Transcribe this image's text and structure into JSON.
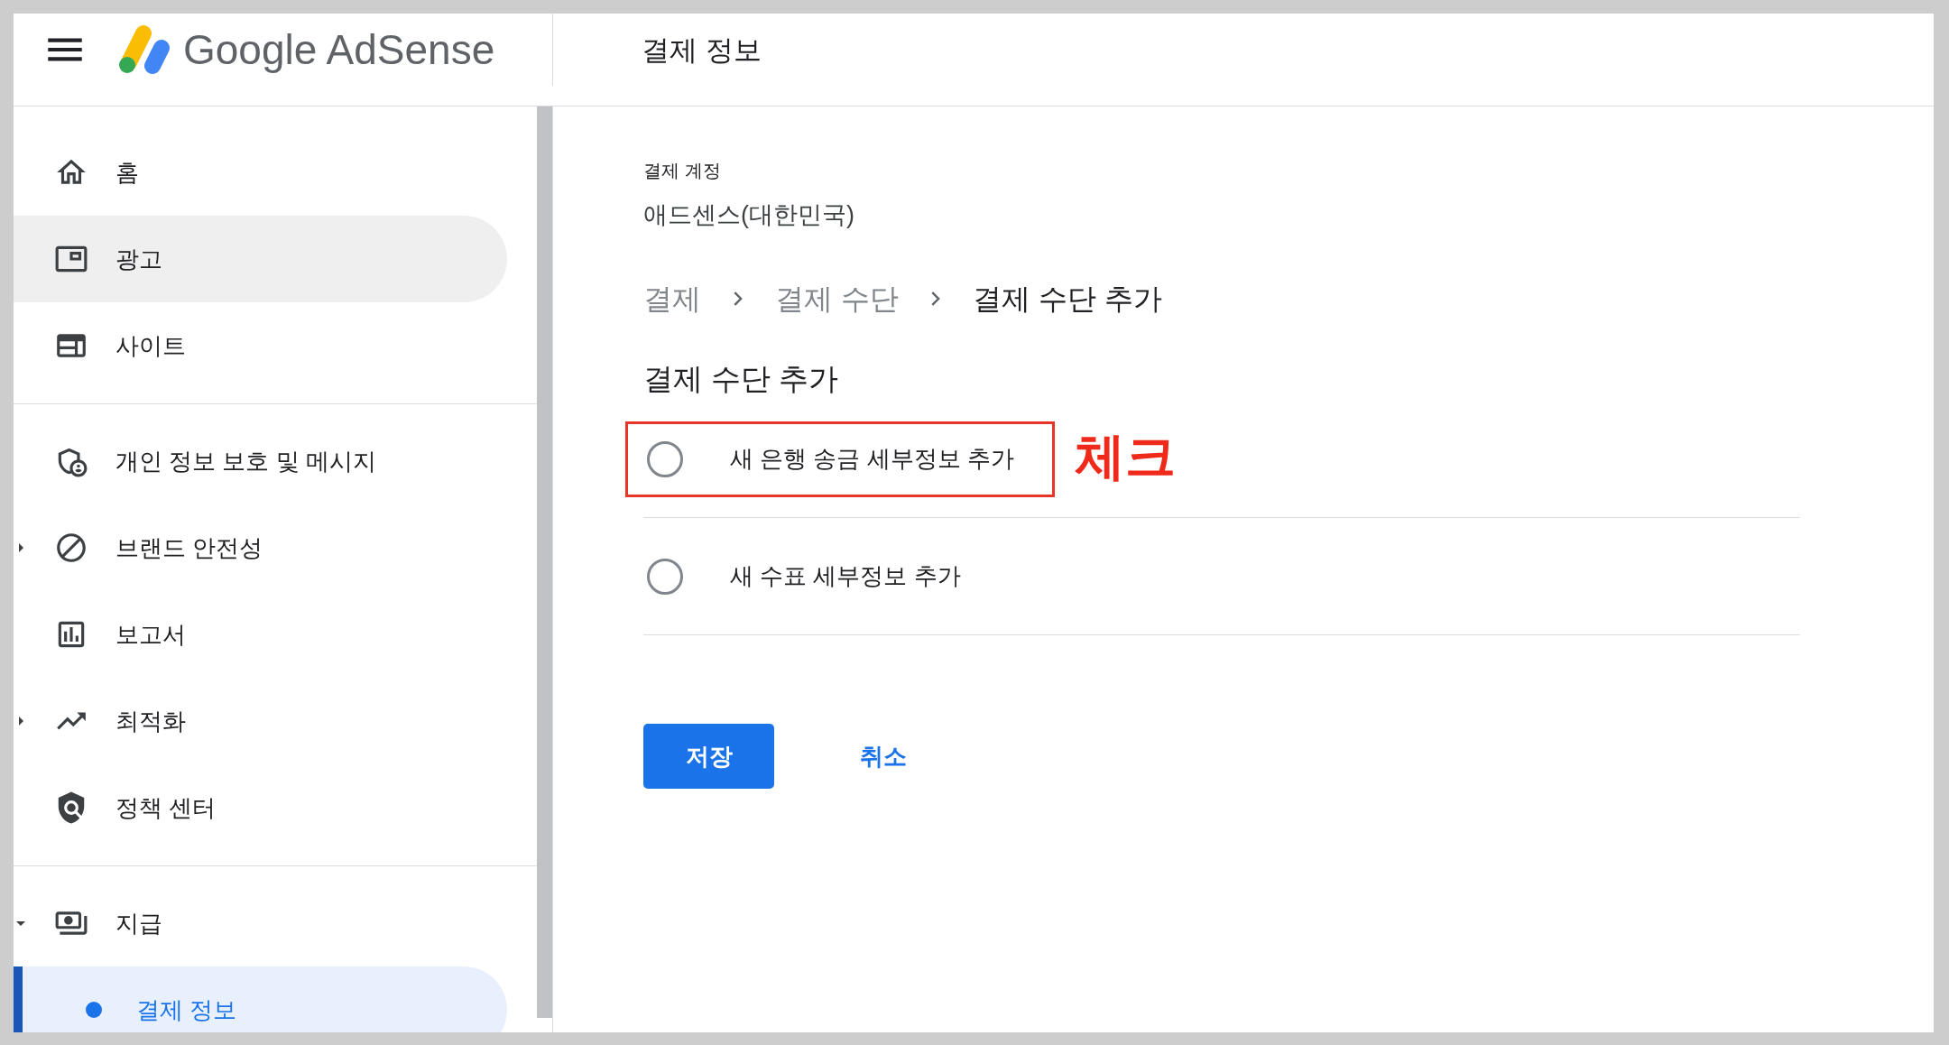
{
  "header": {
    "logo_text": "Google AdSense",
    "title": "결제 정보"
  },
  "sidebar": {
    "sections": [
      {
        "items": [
          {
            "label": "홈",
            "hovered": false,
            "selected": false
          },
          {
            "label": "광고",
            "hovered": true,
            "selected": false
          },
          {
            "label": "사이트",
            "hovered": false,
            "selected": false
          }
        ]
      },
      {
        "items": [
          {
            "label": "개인 정보 보호 및 메시지",
            "hovered": false,
            "selected": false
          },
          {
            "label": "브랜드 안전성",
            "expanded": false,
            "hovered": false,
            "selected": false
          },
          {
            "label": "보고서",
            "hovered": false,
            "selected": false
          },
          {
            "label": "최적화",
            "expanded": false,
            "hovered": false,
            "selected": false
          },
          {
            "label": "정책 센터",
            "hovered": false,
            "selected": false
          }
        ]
      },
      {
        "items": [
          {
            "label": "지급",
            "expanded": true,
            "hovered": false,
            "selected": false,
            "children": [
              {
                "label": "결제 정보",
                "selected": true
              }
            ]
          }
        ]
      }
    ]
  },
  "main": {
    "account": {
      "label": "결제 계정",
      "value": "애드센스(대한민국)"
    },
    "breadcrumb": [
      {
        "label": "결제",
        "current": false
      },
      {
        "label": "결제 수단",
        "current": false
      },
      {
        "label": "결제 수단 추가",
        "current": true
      }
    ],
    "heading": "결제 수단 추가",
    "options": [
      {
        "label": "새 은행 송금 세부정보 추가",
        "selected": false,
        "annotated": true
      },
      {
        "label": "새 수표 세부정보 추가",
        "selected": false,
        "annotated": false
      }
    ],
    "annotation": {
      "label": "체크"
    },
    "buttons": {
      "save": "저장",
      "cancel": "취소"
    }
  }
}
